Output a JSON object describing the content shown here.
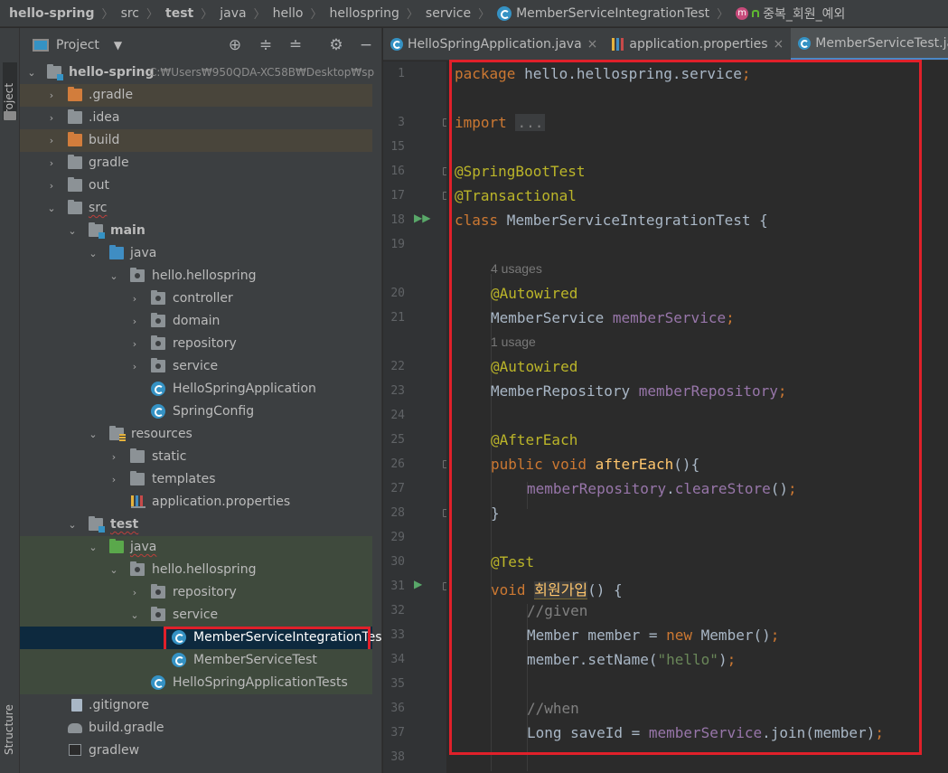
{
  "breadcrumbs": [
    "hello-spring",
    "src",
    "test",
    "java",
    "hello",
    "hellospring",
    "service",
    "MemberServiceIntegrationTest",
    "중복_회원_예외"
  ],
  "side_tabs": {
    "project": "Project",
    "structure": "Structure"
  },
  "panel": {
    "title": "Project",
    "dropdown": "▼"
  },
  "tree": [
    {
      "label": "hello-spring",
      "path": "C:₩Users₩950QDA-XC58B₩Desktop₩sp"
    },
    {
      "label": ".gradle"
    },
    {
      "label": ".idea"
    },
    {
      "label": "build"
    },
    {
      "label": "gradle"
    },
    {
      "label": "out"
    },
    {
      "label": "src"
    },
    {
      "label": "main"
    },
    {
      "label": "java"
    },
    {
      "label": "hello.hellospring"
    },
    {
      "label": "controller"
    },
    {
      "label": "domain"
    },
    {
      "label": "repository"
    },
    {
      "label": "service"
    },
    {
      "label": "HelloSpringApplication"
    },
    {
      "label": "SpringConfig"
    },
    {
      "label": "resources"
    },
    {
      "label": "static"
    },
    {
      "label": "templates"
    },
    {
      "label": "application.properties"
    },
    {
      "label": "test"
    },
    {
      "label": "java"
    },
    {
      "label": "hello.hellospring"
    },
    {
      "label": "repository"
    },
    {
      "label": "service"
    },
    {
      "label": "MemberServiceIntegrationTest"
    },
    {
      "label": "MemberServiceTest"
    },
    {
      "label": "HelloSpringApplicationTests"
    },
    {
      "label": ".gitignore"
    },
    {
      "label": "build.gradle"
    },
    {
      "label": "gradlew"
    }
  ],
  "tabs": [
    {
      "label": "HelloSpringApplication.java"
    },
    {
      "label": "application.properties"
    },
    {
      "label": "MemberServiceTest.java"
    }
  ],
  "line_numbers": [
    "1",
    "3",
    "15",
    "16",
    "17",
    "18",
    "19",
    "20",
    "21",
    "22",
    "23",
    "24",
    "25",
    "26",
    "27",
    "28",
    "29",
    "30",
    "31",
    "32",
    "33",
    "34",
    "35",
    "36",
    "37",
    "38"
  ],
  "hints": [
    "4 usages",
    "1 usage"
  ],
  "code": {
    "l1": {
      "kw": "package",
      "txt": " hello.hellospring.service",
      "semi": ";"
    },
    "l3": {
      "kw": "import",
      "fold": "..."
    },
    "l16": "@SpringBootTest",
    "l17": "@Transactional",
    "l18": {
      "kw": "class",
      "txt": " MemberServiceIntegrationTest {"
    },
    "l20": "@Autowired",
    "l21": {
      "type": "MemberService ",
      "field": "memberService",
      "semi": ";"
    },
    "l22": "@Autowired",
    "l23": {
      "type": "MemberRepository ",
      "field": "memberRepository",
      "semi": ";"
    },
    "l25": "@AfterEach",
    "l26": {
      "kw": "public void ",
      "fn": "afterEach",
      "rest": "(){"
    },
    "l27": {
      "field": "memberRepository",
      "dot": ".",
      "method": "cleareStore",
      "rest": "()",
      "semi": ";"
    },
    "l28": "}",
    "l30": "@Test",
    "l31": {
      "kw": "void ",
      "fn": "회원가입",
      "rest": "() {"
    },
    "l32": "//given",
    "l33": {
      "a": "Member member = ",
      "kw": "new",
      "b": " Member()",
      "semi": ";"
    },
    "l34": {
      "a": "member.setName(",
      "str": "\"hello\"",
      "b": ")",
      "semi": ";"
    },
    "l36": "//when",
    "l37": {
      "a": "Long saveId = ",
      "field": "memberService",
      "b": ".join(member)",
      "semi": ";"
    }
  },
  "colors": {
    "keyword": "#cc7832",
    "annotation": "#bbb529",
    "field": "#9876aa",
    "string": "#6a8759",
    "highlight_box": "#e0202a"
  }
}
